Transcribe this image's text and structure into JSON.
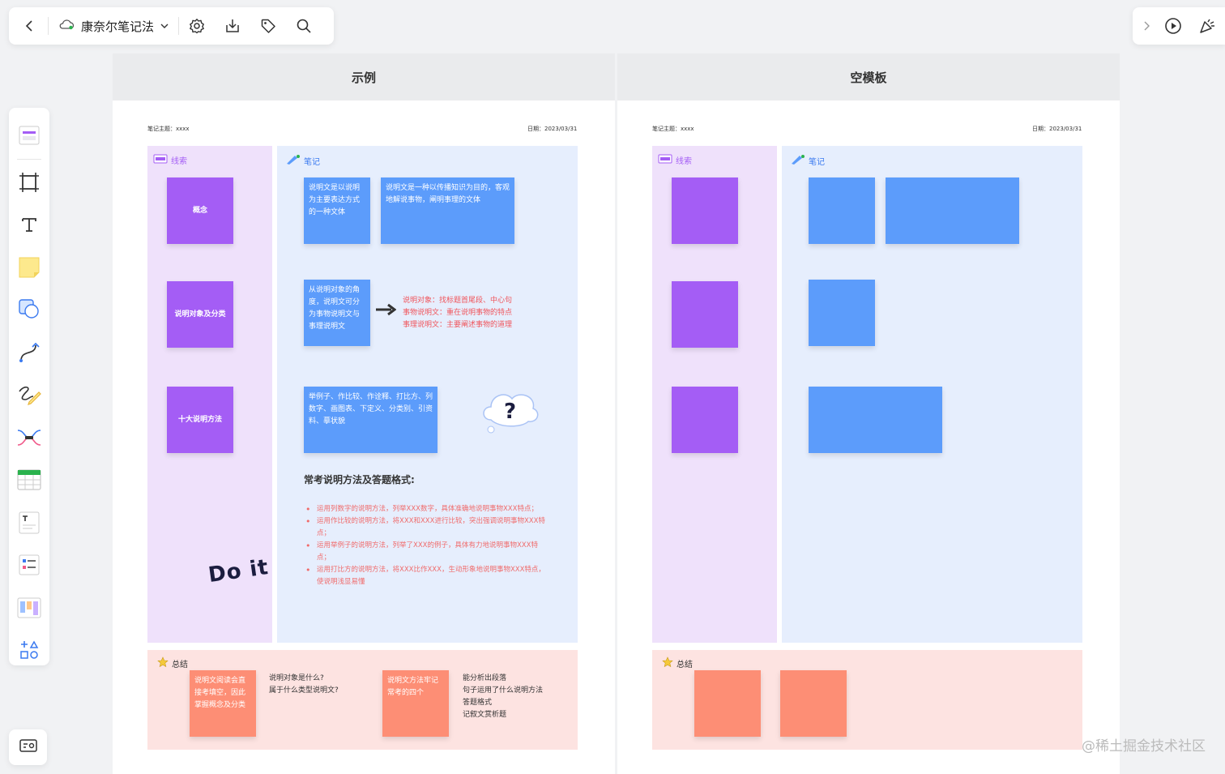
{
  "toolbar": {
    "doc_title": "康奈尔笔记法"
  },
  "frames": {
    "example_title": "示例",
    "blank_title": "空模板"
  },
  "example": {
    "topic": "笔记主题：xxxx",
    "date": "日期：2023/03/31",
    "clue_label": "线索",
    "note_label": "笔记",
    "summary_label": "总结",
    "clues": [
      "概念",
      "说明对象及分类",
      "十大说明方法"
    ],
    "note1": "说明文是以说明为主要表达方式的一种文体",
    "note2": "说明文是一种以传播知识为目的，客观地解说事物，阐明事理的文体",
    "note3": "从说明对象的角度，说明文可分为事物说明文与事理说明文",
    "red_lines": [
      "说明对象：找标题首尾段、中心句",
      "事物说明文：重在说明事物的特点",
      "事理说明文：主要阐述事物的道理"
    ],
    "note4": "举例子、作比较、作诠释、打比方、列数字、画图表、下定义、分类别、引资料、摹状貌",
    "methods_title": "常考说明方法及答题格式:",
    "methods": [
      "运用列数字的说明方法，列举XXX数字，具体准确地说明事物XXX特点；",
      "运用作比较的说明方法，将XXX和XXX进行比较，突出强调说明事物XXX特点；",
      "运用举例子的说明方法，列举了XXX的例子，具体有力地说明事物XXX特点；",
      "运用打比方的说明方法，将XXX比作XXX，生动形象地说明事物XXX特点，使说明浅显易懂"
    ],
    "sticker_doit": "Do it",
    "sum_sticky1": "说明文阅读会直接考填空，因此掌握概念及分类",
    "sum_q": "说明对象是什么?\n属于什么类型说明文?",
    "sum_sticky2": "说明文方法牢记常考的四个",
    "sum_list": "能分析出段落\n句子运用了什么说明方法\n答题格式\n记叙文赏析题"
  },
  "blank": {
    "topic": "笔记主题：xxxx",
    "date": "日期：2023/03/31",
    "clue_label": "线索",
    "note_label": "笔记",
    "summary_label": "总结"
  },
  "watermark": "@稀土掘金技术社区",
  "colors": {
    "clue_bg": "#efe1fb",
    "note_bg": "#e6eefd",
    "summary_bg": "#fde3e1",
    "purple_sticky": "#a45df5",
    "blue_sticky": "#5c9cfb",
    "orange_sticky": "#fd8e75"
  },
  "icons": {
    "left_toolbar": [
      "back-icon",
      "cloud-icon",
      "chevron-down-icon",
      "settings-icon",
      "download-icon",
      "tag-icon",
      "search-icon"
    ],
    "right_toolbar": [
      "chevron-right-icon",
      "play-icon",
      "celebrate-icon"
    ],
    "side_tools": [
      "template-icon",
      "frame-icon",
      "text-icon",
      "sticky-note-icon",
      "shape-icon",
      "connector-icon",
      "pen-icon",
      "mindmap-icon",
      "table-icon",
      "text-card-icon",
      "list-card-icon",
      "kanban-icon",
      "more-shapes-icon"
    ]
  }
}
